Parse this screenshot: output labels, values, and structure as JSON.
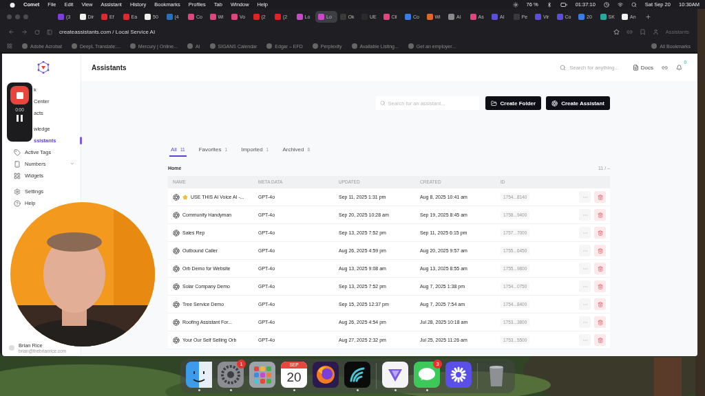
{
  "menu_bar": {
    "app": "Comet",
    "items": [
      "File",
      "Edit",
      "View",
      "Assistant",
      "History",
      "Bookmarks",
      "Profiles",
      "Tab",
      "Window",
      "Help"
    ],
    "battery": "76 %",
    "timer": "01:37:10",
    "date": "Sat Sep 20",
    "time": "10:30AM"
  },
  "tabs": [
    {
      "label": "(3",
      "selected": false,
      "color": "#7b3fd6"
    },
    {
      "label": "Dir",
      "selected": false,
      "color": "#f2f2f2"
    },
    {
      "label": "Ef",
      "selected": false,
      "color": "#d92b2b"
    },
    {
      "label": "Ea",
      "selected": false,
      "color": "#d92b2b"
    },
    {
      "label": "50",
      "selected": false,
      "color": "#f2f2f2"
    },
    {
      "label": "(4",
      "selected": false,
      "color": "#2a6fb8"
    },
    {
      "label": "Co",
      "selected": false,
      "color": "#e0457b"
    },
    {
      "label": "Wi",
      "selected": false,
      "color": "#e0457b"
    },
    {
      "label": "Vo",
      "selected": false,
      "color": "#e0457b"
    },
    {
      "label": "(2",
      "selected": false,
      "color": "#e02424"
    },
    {
      "label": "(2",
      "selected": false,
      "color": "#e02424"
    },
    {
      "label": "Lo",
      "selected": false,
      "color": "#c84ac8"
    },
    {
      "label": "Lo",
      "selected": true,
      "color": "#c84ac8"
    },
    {
      "label": "Ok",
      "selected": false,
      "color": "#3a3a3a"
    },
    {
      "label": "UE",
      "selected": false,
      "color": "#2b2b2b"
    },
    {
      "label": "Cli",
      "selected": false,
      "color": "#e0457b"
    },
    {
      "label": "Co",
      "selected": false,
      "color": "#3b7de0"
    },
    {
      "label": "Wi",
      "selected": false,
      "color": "#e0662a"
    },
    {
      "label": "AI",
      "selected": false,
      "color": "#8a8a8a"
    },
    {
      "label": "As",
      "selected": false,
      "color": "#e0457b"
    },
    {
      "label": "AI",
      "selected": false,
      "color": "#5a4fd6"
    },
    {
      "label": "Pe",
      "selected": false,
      "color": "#3a3a3a"
    },
    {
      "label": "Vir",
      "selected": false,
      "color": "#5a4fd6"
    },
    {
      "label": "Co",
      "selected": false,
      "color": "#5a4fd6"
    },
    {
      "label": "20",
      "selected": false,
      "color": "#3b7de0"
    },
    {
      "label": "SK",
      "selected": false,
      "color": "#2aa89a"
    },
    {
      "label": "An",
      "selected": false,
      "color": "#f2f2f2"
    }
  ],
  "address_bar": {
    "url": "createassistants.com / Local Service AI",
    "assistant_label": "Assistants"
  },
  "bookmarks": [
    "Adobe Acrobat",
    "DeepL Translate:...",
    "Mercury | Online...",
    "AI",
    "SIGANS Calendar",
    "Edgar – EFD",
    "Perplexity",
    "Available Listing...",
    "Get an employer..."
  ],
  "all_bookmarks": "All Bookmarks",
  "sidebar": {
    "sections": [
      {
        "items": [
          {
            "label": "k",
            "selected": false
          },
          {
            "label": "Center",
            "selected": false
          },
          {
            "label": "acts",
            "selected": false
          }
        ]
      },
      {
        "items": [
          {
            "label": "wledge",
            "selected": false
          },
          {
            "label": "ssistants",
            "selected": true
          },
          {
            "label": "Active Tags",
            "selected": false
          },
          {
            "label": "Numbers",
            "selected": false,
            "expanded": false
          },
          {
            "label": "Widgets",
            "selected": false
          }
        ]
      },
      {
        "items": [
          {
            "label": "Settings",
            "selected": false
          },
          {
            "label": "Help",
            "selected": false
          }
        ]
      }
    ],
    "user": {
      "name": "Brian Rice",
      "email": "brian@thebrianrice.com"
    }
  },
  "header": {
    "title": "Assistants",
    "search_placeholder": "Search for anything...",
    "docs": "Docs",
    "notification_badge": "0"
  },
  "toolbar": {
    "search_placeholder": "Search for an assistant...",
    "buttons": [
      "Create Folder",
      "Create Assistant"
    ]
  },
  "filter_tabs": [
    {
      "label": "All",
      "count": "11",
      "selected": true
    },
    {
      "label": "Favorites",
      "count": "1",
      "selected": false
    },
    {
      "label": "Imported",
      "count": "1",
      "selected": false
    },
    {
      "label": "Archived",
      "count": "8",
      "selected": false
    }
  ],
  "folder": "Home",
  "pagination": "11 / –",
  "table": {
    "columns": [
      "NAME",
      "META DATA",
      "UPDATED",
      "CREATED",
      "ID"
    ],
    "rows": [
      {
        "name": "USE THIS AI Voice AI -...",
        "starred": true,
        "meta": "GPT-4o",
        "updated": "Sep 11, 2025 1:31 pm",
        "created": "Aug 8, 2025 10:41 am",
        "id": "1754...8140"
      },
      {
        "name": "Community Handyman",
        "starred": false,
        "meta": "GPT-4o",
        "updated": "Sep 20, 2025 10:28 am",
        "created": "Sep 19, 2025 8:45 am",
        "id": "1758...9400"
      },
      {
        "name": "Sales Rep",
        "starred": false,
        "meta": "GPT-4o",
        "updated": "Sep 13, 2025 7:52 pm",
        "created": "Sep 11, 2025 6:15 pm",
        "id": "1757...7000"
      },
      {
        "name": "Outbound Caller",
        "starred": false,
        "meta": "GPT-4o",
        "updated": "Aug 26, 2025 4:59 pm",
        "created": "Aug 20, 2025 9:57 am",
        "id": "1755...6450"
      },
      {
        "name": "Orb Demo for Website",
        "starred": false,
        "meta": "GPT-4o",
        "updated": "Aug 13, 2025 9:08 am",
        "created": "Aug 13, 2025 8:55 am",
        "id": "1755...9800"
      },
      {
        "name": "Solar Company Demo",
        "starred": false,
        "meta": "GPT-4o",
        "updated": "Sep 13, 2025 7:52 pm",
        "created": "Aug 7, 2025 1:38 pm",
        "id": "1754...0750"
      },
      {
        "name": "Tree Service Demo",
        "starred": false,
        "meta": "GPT-4o",
        "updated": "Sep 15, 2025 12:37 pm",
        "created": "Aug 7, 2025 7:54 am",
        "id": "1754...8400"
      },
      {
        "name": "Roofing Assistant For...",
        "starred": false,
        "meta": "GPT-4o",
        "updated": "Aug 26, 2025 4:54 pm",
        "created": "Jul 28, 2025 10:18 am",
        "id": "1753...3800"
      },
      {
        "name": "Your Our Self Selling Orb",
        "starred": false,
        "meta": "GPT-4o",
        "updated": "Aug 27, 2025 2:32 pm",
        "created": "Jul 25, 2025 11:26 am",
        "id": "1753...5500"
      }
    ]
  },
  "recorder": {
    "time": "0:00"
  },
  "dock": [
    {
      "kind": "finder",
      "running": true
    },
    {
      "kind": "settings",
      "running": true,
      "badge": "1"
    },
    {
      "kind": "launchpad",
      "running": false
    },
    {
      "kind": "calendar",
      "running": true,
      "month": "SEP",
      "day": "20"
    },
    {
      "kind": "firefox",
      "running": false
    },
    {
      "kind": "wave",
      "running": true
    },
    {
      "kind": "separator"
    },
    {
      "kind": "prism",
      "running": true
    },
    {
      "kind": "messages",
      "running": true,
      "badge": "3"
    },
    {
      "kind": "burst",
      "running": false
    },
    {
      "kind": "separator"
    },
    {
      "kind": "trash",
      "running": false
    }
  ]
}
